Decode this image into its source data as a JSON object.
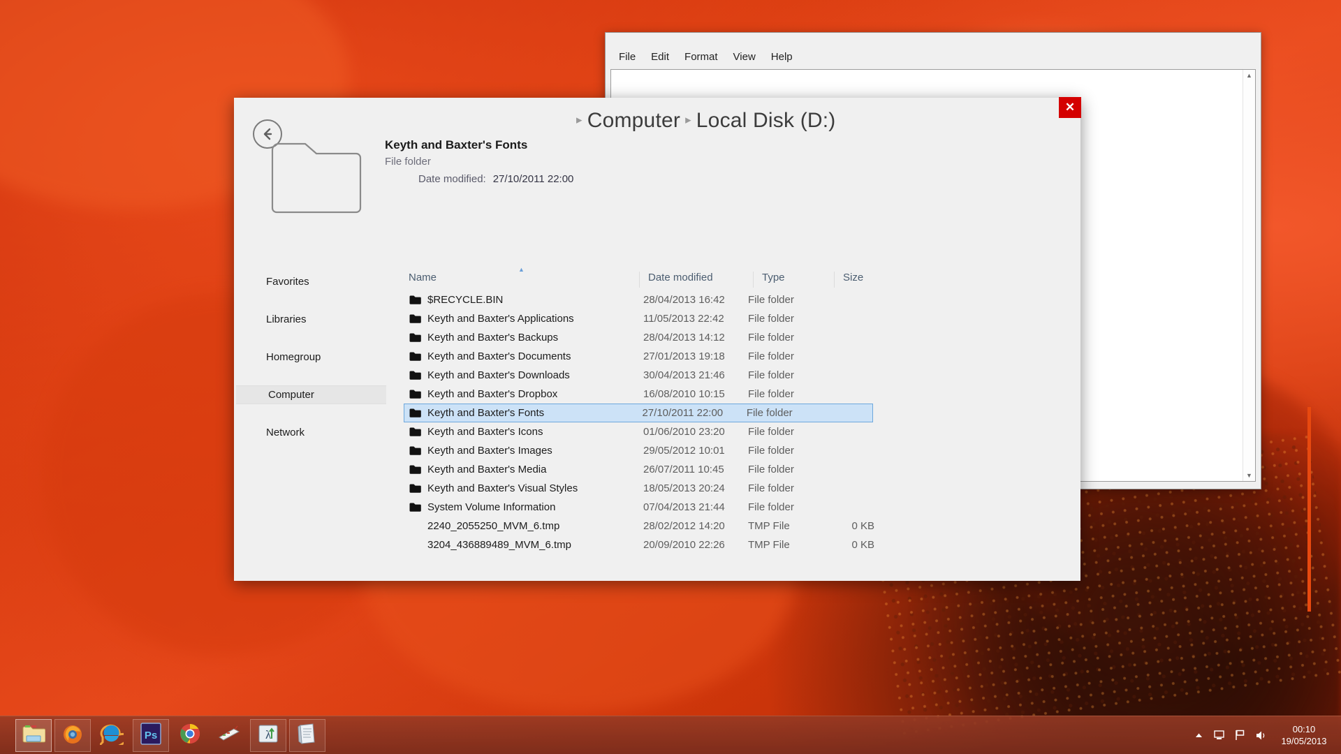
{
  "desktop": {
    "wallpaper_description": "red gerbera flower close-up"
  },
  "notepad": {
    "window_name": "Notepad",
    "menu": [
      "File",
      "Edit",
      "Format",
      "View",
      "Help"
    ],
    "text_content": "",
    "scroll_up": "▲",
    "scroll_down": "▼"
  },
  "explorer": {
    "close_label": "✕",
    "back_tooltip": "Back",
    "breadcrumb": {
      "sep": "▸",
      "items": [
        "Computer",
        "Local Disk (D:)"
      ]
    },
    "details": {
      "title": "Keyth and Baxter's Fonts",
      "type": "File folder",
      "date_label": "Date modified:",
      "date_value": "27/10/2011 22:00"
    },
    "sidebar": {
      "items": [
        {
          "label": "Favorites",
          "selected": false
        },
        {
          "label": "Libraries",
          "selected": false
        },
        {
          "label": "Homegroup",
          "selected": false
        },
        {
          "label": "Computer",
          "selected": true
        },
        {
          "label": "Network",
          "selected": false
        }
      ]
    },
    "columns": {
      "name": "Name",
      "date_modified": "Date modified",
      "type": "Type",
      "size": "Size",
      "sort_indicator": "▲",
      "sorted_by": "Name"
    },
    "rows": [
      {
        "name": "$RECYCLE.BIN",
        "date": "28/04/2013 16:42",
        "type": "File folder",
        "size": "",
        "is_folder": true,
        "selected": false
      },
      {
        "name": "Keyth and Baxter's Applications",
        "date": "11/05/2013 22:42",
        "type": "File folder",
        "size": "",
        "is_folder": true,
        "selected": false
      },
      {
        "name": "Keyth and Baxter's Backups",
        "date": "28/04/2013 14:12",
        "type": "File folder",
        "size": "",
        "is_folder": true,
        "selected": false
      },
      {
        "name": "Keyth and Baxter's Documents",
        "date": "27/01/2013 19:18",
        "type": "File folder",
        "size": "",
        "is_folder": true,
        "selected": false
      },
      {
        "name": "Keyth and Baxter's Downloads",
        "date": "30/04/2013 21:46",
        "type": "File folder",
        "size": "",
        "is_folder": true,
        "selected": false
      },
      {
        "name": "Keyth and Baxter's Dropbox",
        "date": "16/08/2010 10:15",
        "type": "File folder",
        "size": "",
        "is_folder": true,
        "selected": false
      },
      {
        "name": "Keyth and Baxter's Fonts",
        "date": "27/10/2011 22:00",
        "type": "File folder",
        "size": "",
        "is_folder": true,
        "selected": true
      },
      {
        "name": "Keyth and Baxter's Icons",
        "date": "01/06/2010 23:20",
        "type": "File folder",
        "size": "",
        "is_folder": true,
        "selected": false
      },
      {
        "name": "Keyth and Baxter's Images",
        "date": "29/05/2012 10:01",
        "type": "File folder",
        "size": "",
        "is_folder": true,
        "selected": false
      },
      {
        "name": "Keyth and Baxter's Media",
        "date": "26/07/2011 10:45",
        "type": "File folder",
        "size": "",
        "is_folder": true,
        "selected": false
      },
      {
        "name": "Keyth and Baxter's Visual Styles",
        "date": "18/05/2013 20:24",
        "type": "File folder",
        "size": "",
        "is_folder": true,
        "selected": false
      },
      {
        "name": "System Volume Information",
        "date": "07/04/2013 21:44",
        "type": "File folder",
        "size": "",
        "is_folder": true,
        "selected": false
      },
      {
        "name": "2240_2055250_MVM_6.tmp",
        "date": "28/02/2012 14:20",
        "type": "TMP File",
        "size": "0 KB",
        "is_folder": false,
        "selected": false
      },
      {
        "name": "3204_436889489_MVM_6.tmp",
        "date": "20/09/2010 22:26",
        "type": "TMP File",
        "size": "0 KB",
        "is_folder": false,
        "selected": false
      }
    ],
    "scrollbar_color": "#e8490f"
  },
  "taskbar": {
    "apps": [
      {
        "name": "file-explorer",
        "label": "Windows Explorer",
        "state": "active"
      },
      {
        "name": "firefox",
        "label": "Mozilla Firefox",
        "state": "pinned"
      },
      {
        "name": "internet-explorer",
        "label": "Internet Explorer",
        "state": "none"
      },
      {
        "name": "photoshop",
        "label": "Adobe Photoshop",
        "state": "pinned"
      },
      {
        "name": "chrome",
        "label": "Google Chrome",
        "state": "none"
      },
      {
        "name": "keyboard-tool",
        "label": "Keyboard Tool",
        "state": "none"
      },
      {
        "name": "lambda-app",
        "label": "TeXstudio",
        "state": "pinned"
      },
      {
        "name": "notepad",
        "label": "Notepad",
        "state": "pinned"
      }
    ],
    "tray": {
      "show_hidden": "▲",
      "network_label": "Network",
      "action_center_label": "Action Center",
      "volume_label": "Volume",
      "time": "00:10",
      "date": "19/05/2013"
    }
  }
}
